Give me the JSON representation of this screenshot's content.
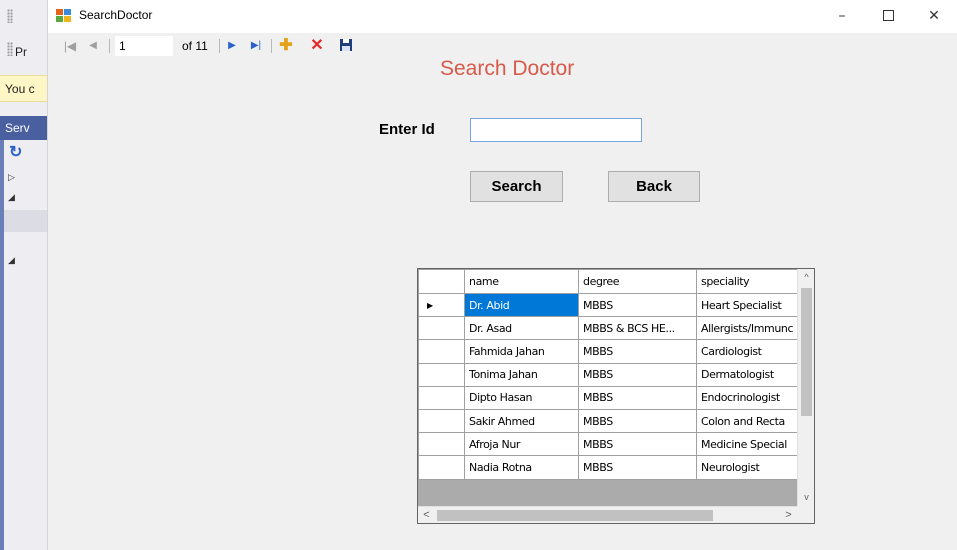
{
  "window": {
    "title": "SearchDoctor",
    "minimize_glyph": "–",
    "close_glyph": "✕"
  },
  "ide": {
    "tab_fragment": "Pr",
    "warn_fragment": "You c",
    "panel_fragment": "Serv",
    "refresh_glyph": "↻"
  },
  "navigator": {
    "position": "1",
    "count_label": "of 11",
    "first_glyph": "|◀",
    "prev_glyph": "◀",
    "next_glyph": "▶",
    "last_glyph": "▶|",
    "add_glyph": "✚",
    "delete_glyph": "✕"
  },
  "form": {
    "heading": "Search Doctor",
    "id_label": "Enter Id",
    "id_value": "",
    "search_label": "Search",
    "back_label": "Back"
  },
  "grid": {
    "columns": [
      "name",
      "degree",
      "speciality"
    ],
    "rows": [
      {
        "name": "Dr. Abid",
        "degree": "MBBS",
        "speciality": "Heart Specialist"
      },
      {
        "name": "Dr. Asad",
        "degree": "MBBS & BCS HE...",
        "speciality": "Allergists/Immunc"
      },
      {
        "name": "Fahmida Jahan",
        "degree": "MBBS",
        "speciality": "Cardiologist"
      },
      {
        "name": "Tonima Jahan",
        "degree": "MBBS",
        "speciality": "Dermatologist"
      },
      {
        "name": "Dipto Hasan",
        "degree": "MBBS",
        "speciality": "Endocrinologist"
      },
      {
        "name": "Sakir Ahmed",
        "degree": "MBBS",
        "speciality": "Colon and Recta"
      },
      {
        "name": "Afroja Nur",
        "degree": "MBBS",
        "speciality": "Medicine Special"
      },
      {
        "name": "Nadia Rotna",
        "degree": "MBBS",
        "speciality": "Neurologist"
      }
    ],
    "current_row_glyph": "▶",
    "scroll_up_glyph": "^",
    "scroll_down_glyph": "v",
    "scroll_left_glyph": "<",
    "scroll_right_glyph": ">"
  },
  "colors": {
    "heading": "#d85a4a",
    "selection": "#0078d7",
    "input_border": "#7aa6e0"
  }
}
